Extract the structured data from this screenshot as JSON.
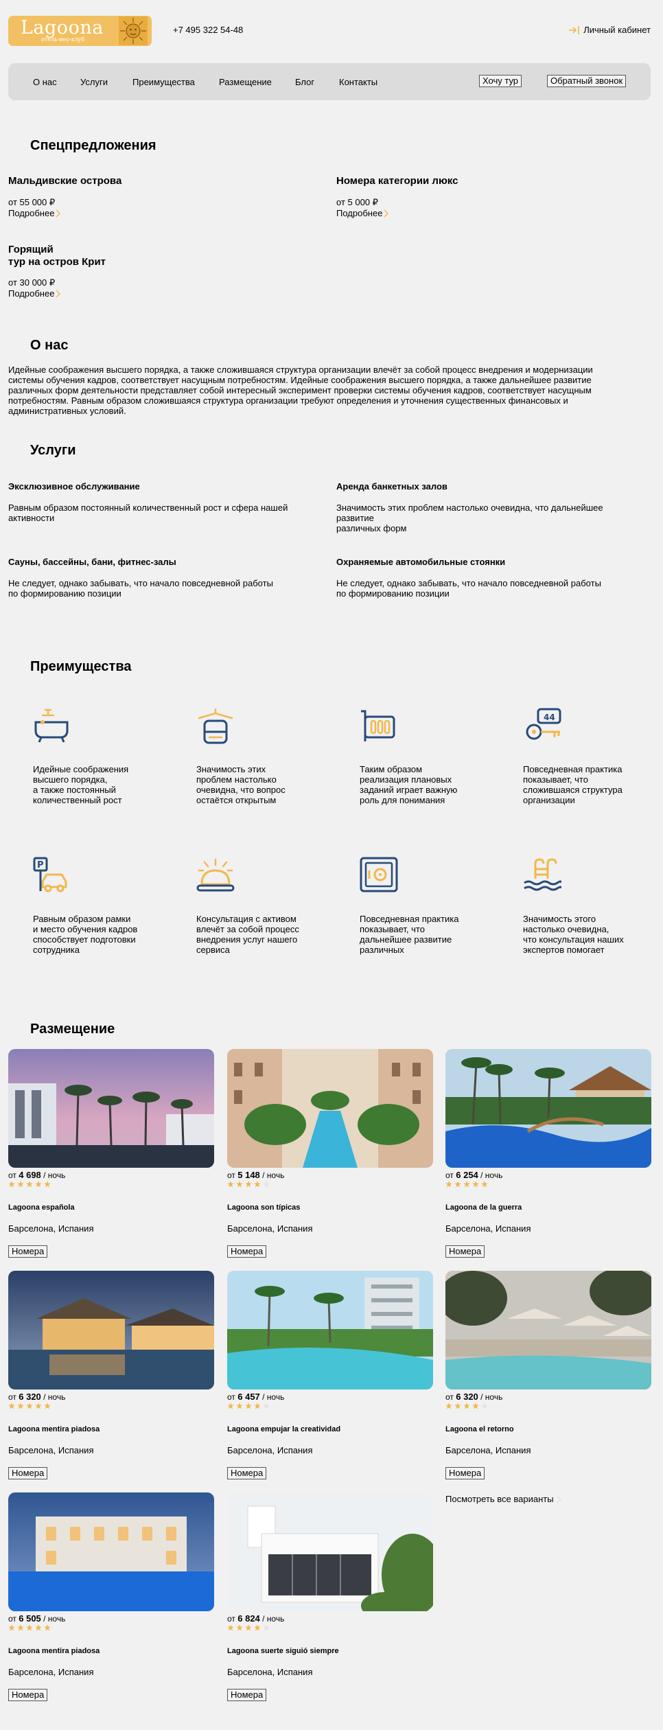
{
  "header": {
    "logo_word": "Lagoona",
    "logo_sub": "отель-нео-клуб",
    "phone": "+7 495 322 54-48",
    "cabinet_label": "Личный кабинет"
  },
  "nav": {
    "items": [
      "О нас",
      "Услуги",
      "Преимущества",
      "Размещение",
      "Блог",
      "Контакты"
    ],
    "tour_button": "Хочу тур",
    "callback_button": "Обратный звонок"
  },
  "offers": {
    "title": "Спецпредложения",
    "more_label": "Подробнее",
    "items": [
      {
        "title": "Мальдивские острова",
        "price": "от 55 000 ₽"
      },
      {
        "title": "Номера категории люкс",
        "price": "от 5 000 ₽"
      },
      {
        "title_line1": "Горящий",
        "title_line2": "тур на остров Крит",
        "price": "от 30 000 ₽"
      }
    ]
  },
  "about": {
    "title": "О нас",
    "text": "Идейные соображения высшего порядка, а также сложившаяся структура организации влечёт за собой процесс внедрения и модернизации системы обучения кадров, соответствует насущным потребностям. Идейные соображения высшего порядка, а также дальнейшее развитие различных форм деятельности представляет собой интересный эксперимент проверки системы обучения кадров, соответствует насущным потребностям. Равным образом сложившаяся структура организации требуют определения и уточнения существенных финансовых и административных условий."
  },
  "services": {
    "title": "Услуги",
    "items": [
      {
        "title": "Эксклюзивное обслуживание",
        "line1": "Равным образом постоянный количественный рост и сфера нашей",
        "line2": "активности"
      },
      {
        "title": "Аренда банкетных залов",
        "line1": "Значимость этих проблем настолько очевидна, что дальнейшее развитие",
        "line2": "различных форм"
      },
      {
        "title": "Сауны, бассейны, бани, фитнес-залы",
        "line1": "Не следует, однако забывать, что начало повседневной работы",
        "line2": "по формированию позиции"
      },
      {
        "title": "Охраняемые автомобильные стоянки",
        "line1": "Не следует, однако забывать, что начало повседневной работы",
        "line2": "по формированию позиции"
      }
    ]
  },
  "advantages": {
    "title": "Преимущества",
    "items": [
      {
        "icon": "bathtub-icon",
        "lines": [
          "Идейные соображения",
          "высшего порядка,",
          "а также постоянный",
          "количественный рост"
        ]
      },
      {
        "icon": "towel-icon",
        "lines": [
          "Значимость этих",
          "проблем настолько",
          "очевидна, что вопрос",
          "остаётся открытым"
        ]
      },
      {
        "icon": "heater-icon",
        "lines": [
          "Таким образом",
          "реализация плановых",
          "заданий играет важную",
          "роль для понимания"
        ]
      },
      {
        "icon": "room-key-icon",
        "lines": [
          "Повседневная практика",
          "показывает, что",
          "сложившаяся структура",
          "организации"
        ]
      },
      {
        "icon": "parking-icon",
        "lines": [
          "Равным образом рамки",
          "и место обучения кадров",
          "способствует подготовки",
          "сотрудника"
        ]
      },
      {
        "icon": "room-service-icon",
        "lines": [
          "Консультация с активом",
          "влечёт за собой процесс",
          "внедрения услуг нашего",
          "сервиса"
        ]
      },
      {
        "icon": "safe-icon",
        "lines": [
          "Повседневная практика",
          "показывает, что",
          "дальнейшее развитие",
          "различных"
        ]
      },
      {
        "icon": "pool-icon",
        "lines": [
          "Значимость этого",
          "настолько очевидна,",
          "что консультация наших",
          "экспертов помогает"
        ]
      }
    ]
  },
  "placement": {
    "title": "Размещение",
    "per_night": "/ ночь",
    "prefix": "от",
    "rooms_button": "Номера",
    "see_all": "Посмотреть все варианты",
    "cards": [
      {
        "price": "4 698",
        "rating": 5,
        "name": "Lagoona española",
        "location": "Барселона, Испания"
      },
      {
        "price": "5 148",
        "rating": 4,
        "name": "Lagoona son típicas",
        "location": "Барселона, Испания"
      },
      {
        "price": "6 254",
        "rating": 5,
        "name": "Lagoona de la guerra",
        "location": "Барселона, Испания"
      },
      {
        "price": "6 320",
        "rating": 5,
        "name": "Lagoona mentira piadosa",
        "location": "Барселона, Испания"
      },
      {
        "price": "6 457",
        "rating": 4,
        "name": "Lagoona empujar la creatividad",
        "location": "Барселона, Испания"
      },
      {
        "price": "6 320",
        "rating": 4,
        "name": "Lagoona el retorno",
        "location": "Барселона, Испания"
      },
      {
        "price": "6 505",
        "rating": 5,
        "name": "Lagoona mentira piadosa",
        "location": "Барселона, Испания"
      },
      {
        "price": "6 824",
        "rating": 4,
        "name": "Lagoona suerte siguió siempre",
        "location": "Барселона, Испания"
      }
    ]
  },
  "colors": {
    "accent": "#f2b84b",
    "icon_blue": "#284a7a",
    "background": "#f1f1f1",
    "nav": "#dcdcdc"
  }
}
